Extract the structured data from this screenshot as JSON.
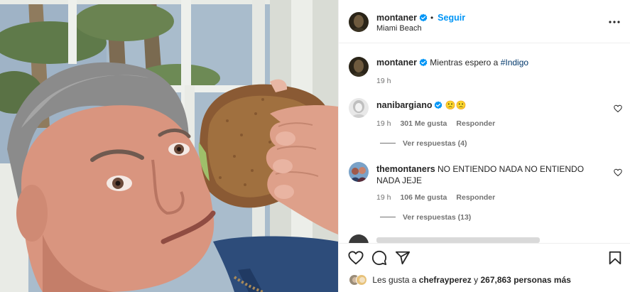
{
  "post": {
    "author": "montaner",
    "follow_label": "Seguir",
    "separator": "•",
    "location": "Miami Beach"
  },
  "caption": {
    "author": "montaner",
    "text": "Mientras espero a",
    "hashtag": "#Indigo",
    "time": "19 h"
  },
  "comments": [
    {
      "author": "nanibargiano",
      "text": "🙁🙁",
      "time": "19 h",
      "likes": "301 Me gusta",
      "reply_label": "Responder",
      "view_replies": "Ver respuestas (4)"
    },
    {
      "author": "themontaners",
      "text": "NO ENTIENDO NADA NO ENTIENDO NADA JEJE",
      "time": "19 h",
      "likes": "106 Me gusta",
      "reply_label": "Responder",
      "view_replies": "Ver respuestas (13)"
    }
  ],
  "likes": {
    "prefix": "Les gusta a",
    "user": "chefrayperez",
    "middle": "y",
    "count": "267,863",
    "suffix": "personas más"
  },
  "icons": {
    "verified": "verified-badge-icon",
    "more": "more-options-icon",
    "heart": "heart-icon",
    "comment": "comment-icon",
    "share": "share-icon",
    "save": "bookmark-icon"
  },
  "colors": {
    "link": "#0095f6",
    "verified": "#0095f6",
    "hashtag": "#00376b",
    "muted": "#737373"
  }
}
